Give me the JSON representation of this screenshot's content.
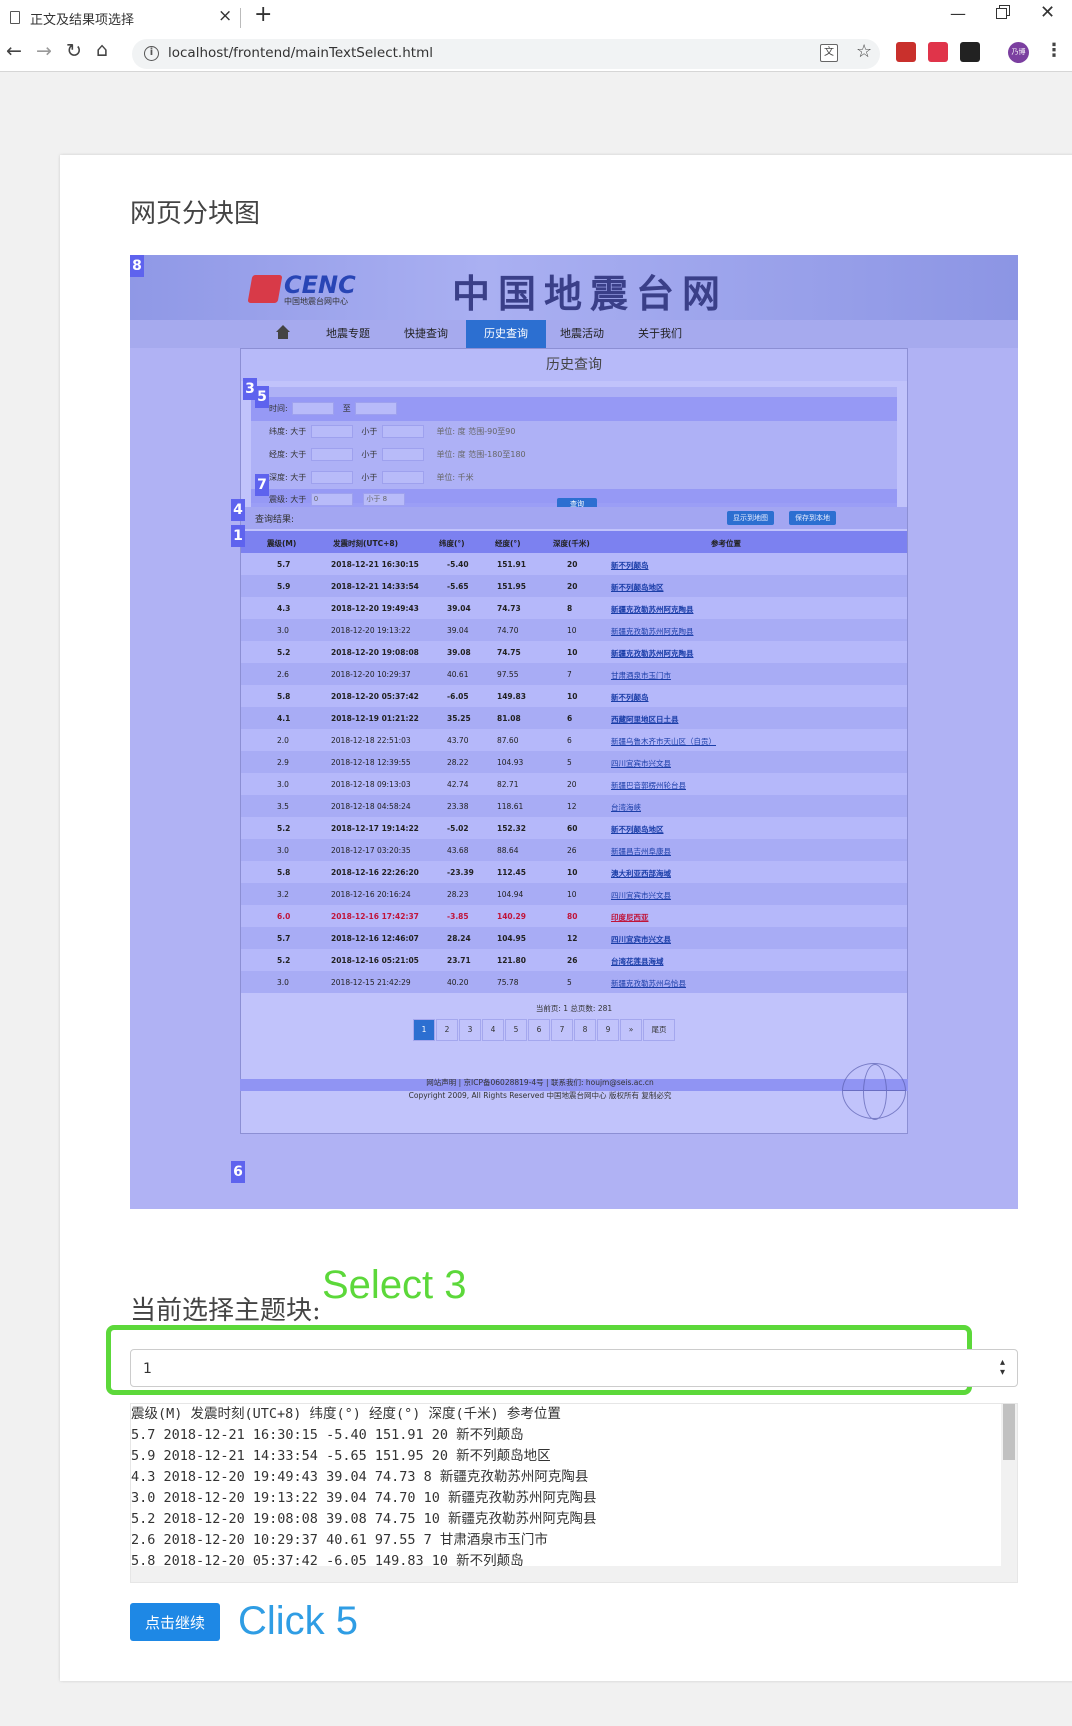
{
  "browser": {
    "tab_title": "正文及结果项选择",
    "url": "localhost/frontend/mainTextSelect.html",
    "avatar_text": "乃博",
    "translate_glyph": "文"
  },
  "page": {
    "heading": "网页分块图",
    "select_heading": "当前选择主题块:",
    "select_note": "Select 3",
    "select_value": "1",
    "continue_label": "点击继续",
    "click_note": "Click 5",
    "text_lines": [
      "震级(M) 发震时刻(UTC+8) 纬度(°) 经度(°) 深度(千米) 参考位置",
      "5.7 2018-12-21 16:30:15 -5.40 151.91 20 新不列颠岛",
      "5.9 2018-12-21 14:33:54 -5.65 151.95 20 新不列颠岛地区",
      "4.3 2018-12-20 19:49:43 39.04 74.73 8 新疆克孜勒苏州阿克陶县",
      "3.0 2018-12-20 19:13:22 39.04 74.70 10 新疆克孜勒苏州阿克陶县",
      "5.2 2018-12-20 19:08:08 39.08 74.75 10 新疆克孜勒苏州阿克陶县",
      "2.6 2018-12-20 10:29:37 40.61 97.55 7 甘肃酒泉市玉门市",
      "5.8 2018-12-20 05:37:42 -6.05 149.83 10 新不列颠岛"
    ]
  },
  "shot": {
    "logo_text": "CENC",
    "logo_sub": "中国地震台网中心",
    "site_title": "中国地震台网",
    "nav": [
      "地震专题",
      "快捷查询",
      "历史查询",
      "地震活动",
      "关于我们"
    ],
    "nav_active": "历史查询",
    "panel_title": "历史查询",
    "form": {
      "row1_label": "时间:",
      "row1_mid": "至",
      "lat_label": "纬度: 大于",
      "lat_hint": "单位: 度 范围-90至90",
      "lon_label": "经度: 大于",
      "lon_hint": "单位: 度 范围-180至180",
      "depth_label": "深度: 大于",
      "depth_hint": "单位: 千米",
      "mag_label": "震级: 大于",
      "mag_min": "0",
      "mag_max": "小于 8",
      "lt": "小于",
      "query_btn": "查询"
    },
    "results_label": "查询结果:",
    "map_btn": "显示到地图",
    "save_btn": "保存到本地",
    "headers": [
      "震级(M)",
      "发震时刻(UTC+8)",
      "纬度(°)",
      "经度(°)",
      "深度(千米)",
      "参考位置"
    ],
    "rows": [
      [
        "5.7",
        "2018-12-21 16:30:15",
        "-5.40",
        "151.91",
        "20",
        "新不列颠岛"
      ],
      [
        "5.9",
        "2018-12-21 14:33:54",
        "-5.65",
        "151.95",
        "20",
        "新不列颠岛地区"
      ],
      [
        "4.3",
        "2018-12-20 19:49:43",
        "39.04",
        "74.73",
        "8",
        "新疆克孜勒苏州阿克陶县"
      ],
      [
        "3.0",
        "2018-12-20 19:13:22",
        "39.04",
        "74.70",
        "10",
        "新疆克孜勒苏州阿克陶县"
      ],
      [
        "5.2",
        "2018-12-20 19:08:08",
        "39.08",
        "74.75",
        "10",
        "新疆克孜勒苏州阿克陶县"
      ],
      [
        "2.6",
        "2018-12-20 10:29:37",
        "40.61",
        "97.55",
        "7",
        "甘肃酒泉市玉门市"
      ],
      [
        "5.8",
        "2018-12-20 05:37:42",
        "-6.05",
        "149.83",
        "10",
        "新不列颠岛"
      ],
      [
        "4.1",
        "2018-12-19 01:21:22",
        "35.25",
        "81.08",
        "6",
        "西藏阿里地区日土县"
      ],
      [
        "2.0",
        "2018-12-18 22:51:03",
        "43.70",
        "87.60",
        "6",
        "新疆乌鲁木齐市天山区（自贡）"
      ],
      [
        "2.9",
        "2018-12-18 12:39:55",
        "28.22",
        "104.93",
        "5",
        "四川宜宾市兴文县"
      ],
      [
        "3.0",
        "2018-12-18 09:13:03",
        "42.74",
        "82.71",
        "20",
        "新疆巴音郭楞州轮台县"
      ],
      [
        "3.5",
        "2018-12-18 04:58:24",
        "23.38",
        "118.61",
        "12",
        "台湾海峡"
      ],
      [
        "5.2",
        "2018-12-17 19:14:22",
        "-5.02",
        "152.32",
        "60",
        "新不列颠岛地区"
      ],
      [
        "3.0",
        "2018-12-17 03:20:35",
        "43.68",
        "88.64",
        "26",
        "新疆昌吉州阜康县"
      ],
      [
        "5.8",
        "2018-12-16 22:26:20",
        "-23.39",
        "112.45",
        "10",
        "澳大利亚西部海域"
      ],
      [
        "3.2",
        "2018-12-16 20:16:24",
        "28.23",
        "104.94",
        "10",
        "四川宜宾市兴文县"
      ],
      [
        "6.0",
        "2018-12-16 17:42:37",
        "-3.85",
        "140.29",
        "80",
        "印度尼西亚"
      ],
      [
        "5.7",
        "2018-12-16 12:46:07",
        "28.24",
        "104.95",
        "12",
        "四川宜宾市兴文县"
      ],
      [
        "5.2",
        "2018-12-16 05:21:05",
        "23.71",
        "121.80",
        "26",
        "台湾花莲县海域"
      ],
      [
        "3.0",
        "2018-12-15 21:42:29",
        "40.20",
        "75.78",
        "5",
        "新疆克孜勒苏州乌恰县"
      ]
    ],
    "pager_info": "当前页: 1  总页数: 281",
    "pages": [
      "1",
      "2",
      "3",
      "4",
      "5",
      "6",
      "7",
      "8",
      "9",
      "»",
      "尾页"
    ],
    "footer1": "网站声明 | 京ICP备06028819-4号 | 联系我们: houjm@seis.ac.cn",
    "footer2": "Copyright 2009, All Rights Reserved 中国地震台网中心 版权所有 复制必究",
    "block_numbers": [
      "8",
      "3",
      "5",
      "7",
      "4",
      "1",
      "6"
    ]
  }
}
